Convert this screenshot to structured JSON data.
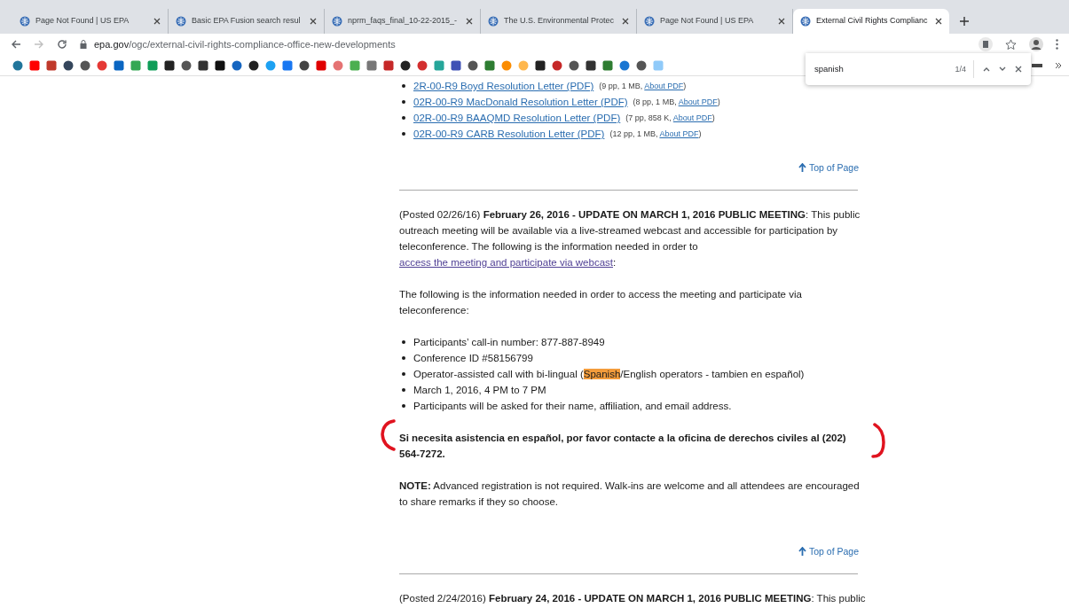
{
  "tabs": [
    {
      "title": "Page Not Found | US EPA",
      "selected": false
    },
    {
      "title": "Basic EPA Fusion search resul",
      "selected": false
    },
    {
      "title": "nprm_faqs_final_10-22-2015_-",
      "selected": false
    },
    {
      "title": "The U.S. Environmental Protec",
      "selected": false
    },
    {
      "title": "Page Not Found | US EPA",
      "selected": false
    },
    {
      "title": "External Civil Rights Complianc",
      "selected": true
    }
  ],
  "address_bar": {
    "host": "epa.gov",
    "path": "/ogc/external-civil-rights-compliance-office-new-developments"
  },
  "bookmarks": [
    {
      "kind": "circle",
      "color": "#21759b"
    },
    {
      "kind": "square",
      "color": "#ff0000"
    },
    {
      "kind": "square",
      "color": "#c0392b"
    },
    {
      "kind": "circle",
      "color": "#35465c"
    },
    {
      "kind": "circle",
      "color": "#555555"
    },
    {
      "kind": "circle",
      "color": "#e53935"
    },
    {
      "kind": "square",
      "color": "#0a66c2"
    },
    {
      "kind": "square",
      "color": "#34a853"
    },
    {
      "kind": "square",
      "color": "#0f9d58"
    },
    {
      "kind": "square",
      "color": "#222222"
    },
    {
      "kind": "circle",
      "color": "#555555"
    },
    {
      "kind": "square",
      "color": "#333333"
    },
    {
      "kind": "square",
      "color": "#111111"
    },
    {
      "kind": "circle",
      "color": "#1565c0"
    },
    {
      "kind": "circle",
      "color": "#222222"
    },
    {
      "kind": "circle",
      "color": "#1da1f2"
    },
    {
      "kind": "square",
      "color": "#1877f2"
    },
    {
      "kind": "circle",
      "color": "#444444"
    },
    {
      "kind": "square",
      "color": "#e00000"
    },
    {
      "kind": "circle",
      "color": "#e57373"
    },
    {
      "kind": "square",
      "color": "#4caf50"
    },
    {
      "kind": "square",
      "color": "#777777"
    },
    {
      "kind": "square",
      "color": "#c62828"
    },
    {
      "kind": "circle",
      "color": "#222222"
    },
    {
      "kind": "circle",
      "color": "#d32f2f"
    },
    {
      "kind": "square",
      "color": "#26a69a"
    },
    {
      "kind": "square",
      "color": "#3f51b5"
    },
    {
      "kind": "circle",
      "color": "#555555"
    },
    {
      "kind": "square",
      "color": "#2e7d32"
    },
    {
      "kind": "circle",
      "color": "#fb8c00"
    },
    {
      "kind": "circle",
      "color": "#ffb74d"
    },
    {
      "kind": "square",
      "color": "#222222"
    },
    {
      "kind": "circle",
      "color": "#c62828"
    },
    {
      "kind": "circle",
      "color": "#555555"
    },
    {
      "kind": "square",
      "color": "#333333"
    },
    {
      "kind": "square",
      "color": "#2e7d32"
    },
    {
      "kind": "circle",
      "color": "#1976d2"
    },
    {
      "kind": "circle",
      "color": "#555555"
    },
    {
      "kind": "square",
      "color": "#90caf9"
    }
  ],
  "find_bar": {
    "value": "spanish",
    "count": "1/4"
  },
  "documents": [
    {
      "title": "2R-00-R9 Boyd Resolution Letter (PDF)",
      "info": "(9 pp, 1 MB, ",
      "link": "About PDF",
      "close": ")"
    },
    {
      "title": "02R-00-R9 MacDonald Resolution Letter (PDF)",
      "info": "(8 pp, 1 MB, ",
      "link": "About PDF",
      "close": ")"
    },
    {
      "title": "02R-00-R9 BAAQMD Resolution Letter (PDF)",
      "info": "(7 pp, 858 K, ",
      "link": "About PDF",
      "close": ")"
    },
    {
      "title": "02R-00-R9 CARB Resolution Letter (PDF)",
      "info": "(12 pp, 1 MB, ",
      "link": "About PDF",
      "close": ")"
    }
  ],
  "top_link_1": "Top of Page",
  "intro": {
    "text": "(Posted 02/26/16) **February 26, 2016 - UPDATE ON MARCH 1, 2016 PUBLIC MEETING**: This public outreach meeting will be available via a live-streamed webcast and accessible for participation by teleconference.  The following is the information needed in order to ",
    "link": "access the meeting and participate via webcast",
    "after": ":"
  },
  "info_paragraph": "The following is the information needed in order to access the meeting and participate via teleconference:",
  "bullets": [
    {
      "segments": [
        {
          "text": "Participants’ call-in number: 877-887-8949",
          "highlighted": false
        }
      ]
    },
    {
      "segments": [
        {
          "text": "Conference ID #58156799",
          "highlighted": false
        }
      ]
    },
    {
      "segments": [
        {
          "text": "Operator-assisted call with bi-lingual (",
          "highlighted": false
        },
        {
          "text": "Spanish",
          "highlighted": true
        },
        {
          "text": "/English operators - tambien en español)",
          "highlighted": false
        }
      ]
    },
    {
      "segments": [
        {
          "text": "March 1, 2016, 4 PM to 7 PM",
          "highlighted": false
        }
      ]
    },
    {
      "segments": [
        {
          "text": "Participants will be asked for their name, affiliation, and email address.",
          "highlighted": false
        }
      ]
    }
  ],
  "spanish_notice": {
    "text": "Si necesita asistencia en español, por favor contacte a la oficina de derechos civiles al (202) 564-7272."
  },
  "note": "**NOTE:**  Advanced registration is not required.  Walk-ins are welcome and  all attendees are encouraged to share remarks if they so choose.",
  "top_link_2": "Top of Page",
  "next_post": "(Posted 2/24/2016) **February 24, 2016 - UPDATE ON MARCH 1, 2016 PUBLIC MEETING**: This public"
}
